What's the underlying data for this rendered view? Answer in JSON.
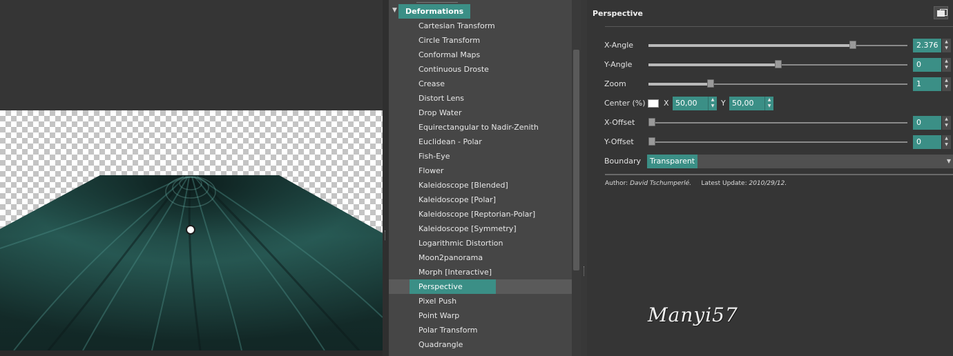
{
  "tree": {
    "category": "Deformations",
    "items": [
      {
        "label": "Cartesian Transform"
      },
      {
        "label": "Circle Transform"
      },
      {
        "label": "Conformal Maps"
      },
      {
        "label": "Continuous Droste"
      },
      {
        "label": "Crease"
      },
      {
        "label": "Distort Lens"
      },
      {
        "label": "Drop Water"
      },
      {
        "label": "Equirectangular to Nadir-Zenith"
      },
      {
        "label": "Euclidean - Polar"
      },
      {
        "label": "Fish-Eye"
      },
      {
        "label": "Flower"
      },
      {
        "label": "Kaleidoscope [Blended]"
      },
      {
        "label": "Kaleidoscope [Polar]"
      },
      {
        "label": "Kaleidoscope [Reptorian-Polar]"
      },
      {
        "label": "Kaleidoscope [Symmetry]"
      },
      {
        "label": "Logarithmic Distortion"
      },
      {
        "label": "Moon2panorama"
      },
      {
        "label": "Morph [Interactive]"
      },
      {
        "label": "Perspective",
        "selected": true
      },
      {
        "label": "Pixel Push"
      },
      {
        "label": "Point Warp"
      },
      {
        "label": "Polar Transform"
      },
      {
        "label": "Quadrangle"
      }
    ]
  },
  "params": {
    "title": "Perspective",
    "x_angle": {
      "label": "X-Angle",
      "value": "2.376",
      "level": 0.79
    },
    "y_angle": {
      "label": "Y-Angle",
      "value": "0",
      "level": 0.5
    },
    "zoom": {
      "label": "Zoom",
      "value": "1",
      "level": 0.24
    },
    "center": {
      "label": "Center (%)",
      "x_label": "X",
      "x_value": "50,00",
      "y_label": "Y",
      "y_value": "50,00",
      "color": "#ffffff"
    },
    "x_offset": {
      "label": "X-Offset",
      "value": "0",
      "level": 0.0
    },
    "y_offset": {
      "label": "Y-Offset",
      "value": "0",
      "level": 0.0
    },
    "boundary": {
      "label": "Boundary",
      "value": "Transparent"
    }
  },
  "credits": {
    "author_label": "Author:",
    "author": "David Tschumperlé.",
    "update_label": "Latest Update:",
    "update": "2010/29/12."
  },
  "watermark": "Manyi57",
  "colors": {
    "accent": "#3b8f86",
    "panel": "#353535",
    "tree": "#464646"
  }
}
